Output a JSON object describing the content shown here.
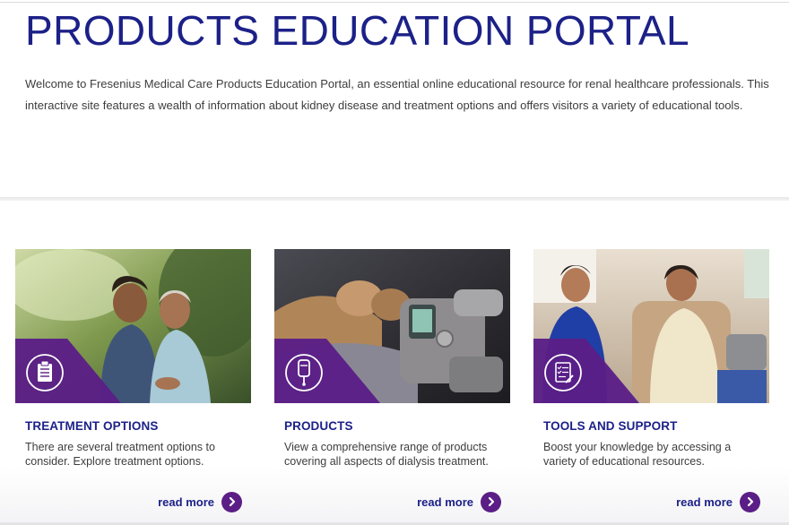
{
  "hero": {
    "title": "PRODUCTS EDUCATION PORTAL",
    "intro": "Welcome to Fresenius Medical Care Products Education Portal, an essential online educational resource for renal healthcare professionals. This interactive site features a wealth of information about kidney disease and treatment options and offers visitors a variety of educational tools."
  },
  "colors": {
    "title_blue": "#1c2188",
    "badge_purple": "#5b1e86",
    "body_text": "#3d3d3d"
  },
  "cards": [
    {
      "title": "TREATMENT OPTIONS",
      "description": "There are several treatment options to consider. Explore treatment options.",
      "link": "read more",
      "badge_icon": "clipboard-icon"
    },
    {
      "title": "PRODUCTS",
      "description": "View a comprehensive range of products covering all aspects of dialysis treatment.",
      "link": "read more",
      "badge_icon": "iv-bag-icon"
    },
    {
      "title": "TOOLS AND SUPPORT",
      "description": "Boost your knowledge by accessing a variety of educational resources.",
      "link": "read more",
      "badge_icon": "checklist-icon"
    }
  ]
}
